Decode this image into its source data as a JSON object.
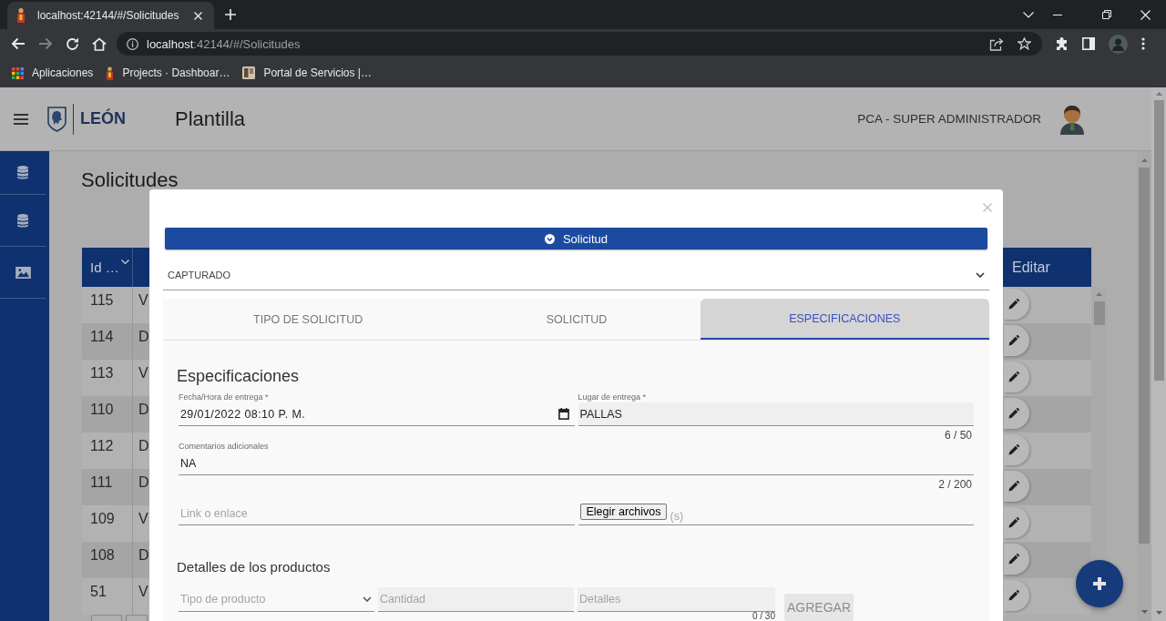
{
  "browser": {
    "tabs": [
      {
        "title": "localhost:42144/#/Solicitudes",
        "selected": true
      }
    ],
    "address": {
      "host": "localhost",
      "rest": ":42144/#/Solicitudes"
    },
    "bookmarks": [
      {
        "kind": "apps",
        "label": "Aplicaciones"
      },
      {
        "kind": "figure",
        "label": "Projects · Dashboar…"
      },
      {
        "kind": "tile",
        "label": "Portal de Servicios |…"
      }
    ]
  },
  "header": {
    "logo_text": "LEÓN",
    "title": "Plantilla",
    "user": "PCA - SUPER ADMINISTRADOR"
  },
  "sidebar": {
    "items": [
      {
        "kind": "database"
      },
      {
        "kind": "database"
      },
      {
        "kind": "image"
      }
    ]
  },
  "page": {
    "title": "Solicitudes",
    "table": {
      "id_heading": "Id …",
      "edit_heading": "Editar",
      "rows": [
        {
          "id": "115",
          "column_2": "V"
        },
        {
          "id": "114",
          "column_2": "D"
        },
        {
          "id": "113",
          "column_2": "V"
        },
        {
          "id": "110",
          "column_2": "D"
        },
        {
          "id": "112",
          "column_2": "D"
        },
        {
          "id": "111",
          "column_2": "D"
        },
        {
          "id": "109",
          "column_2": "V"
        },
        {
          "id": "108",
          "column_2": "D"
        },
        {
          "id": "51",
          "column_2": "V"
        }
      ]
    }
  },
  "modal": {
    "banner": "Solicitud",
    "status": "CAPTURADO",
    "tabs": [
      {
        "label": "TIPO DE SOLICITUD",
        "selected": false
      },
      {
        "label": "SOLICITUD",
        "selected": false
      },
      {
        "label": "ESPECIFICACIONES",
        "selected": true
      }
    ],
    "section_title": "Especificaciones",
    "delivery_date": {
      "label": "Fecha/Hora de entrega *",
      "value": "29/01/2022 08:10 P. M."
    },
    "delivery_place": {
      "label": "Lugar de entrega *",
      "value": "PALLAS",
      "counter": "6 / 50"
    },
    "comments": {
      "label": "Comentarios adicionales",
      "value": "NA",
      "counter": "2 / 200"
    },
    "link": {
      "placeholder": "Link o enlace"
    },
    "attachments": {
      "button": "Elegir archivos",
      "placeholder": "(s)"
    },
    "products": {
      "title": "Detalles de los productos",
      "type": {
        "placeholder": "Tipo de producto"
      },
      "quantity": {
        "placeholder": "Cantidad"
      },
      "details": {
        "placeholder": "Detalles",
        "counter": "0 / 30"
      },
      "add_button": {
        "label": "AGREGAR",
        "disabled": true
      }
    }
  }
}
